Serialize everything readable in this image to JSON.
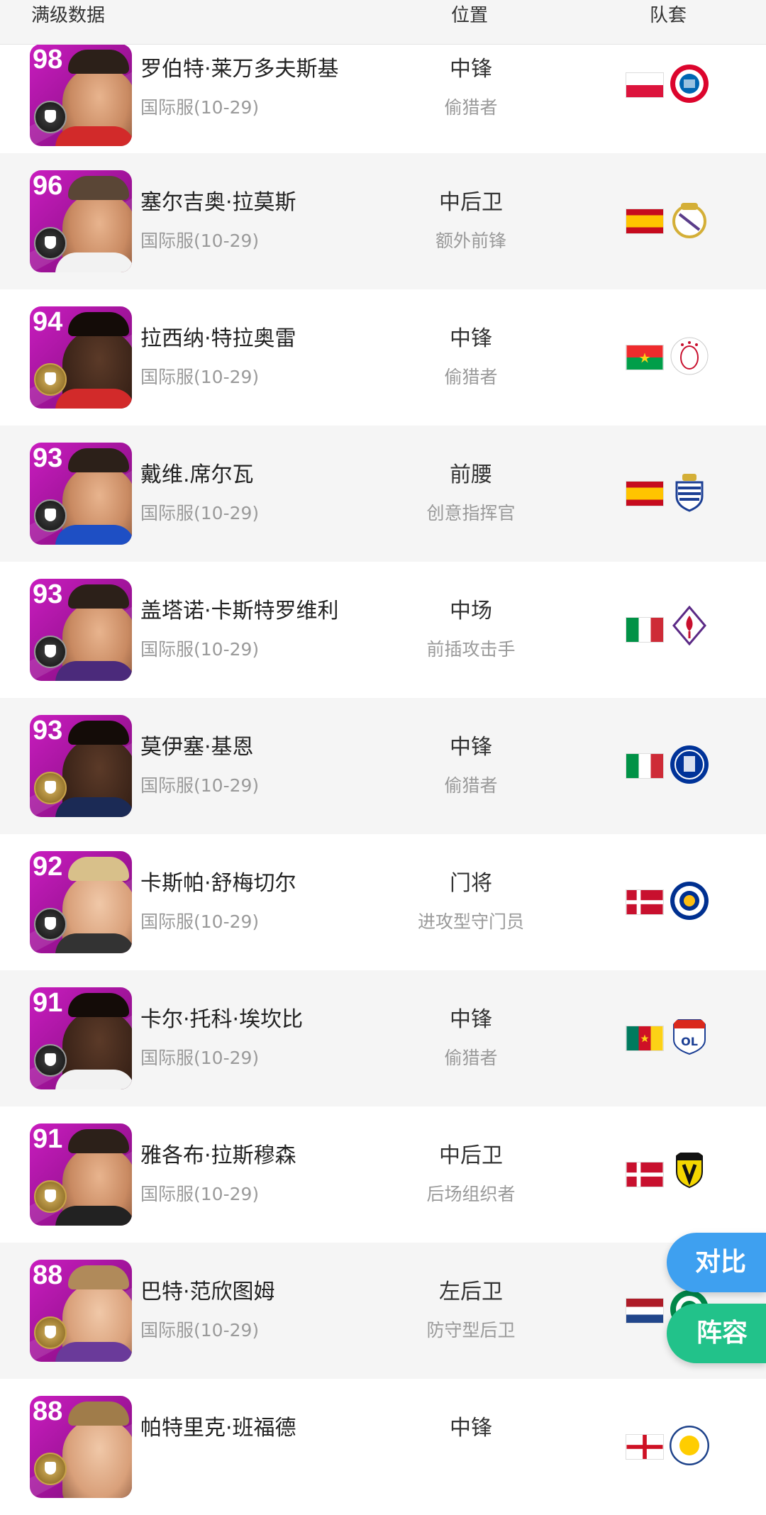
{
  "header": {
    "name_col": "满级数据",
    "pos_col": "位置",
    "team_col": "队套"
  },
  "players": [
    {
      "rating": "98",
      "name": "罗伯特·莱万多夫斯基",
      "server": "国际服(10-29)",
      "position": "中锋",
      "role": "偷猎者",
      "flag": "poland",
      "club": "bayern-munich",
      "badge": "black"
    },
    {
      "rating": "96",
      "name": "塞尔吉奥·拉莫斯",
      "server": "国际服(10-29)",
      "position": "中后卫",
      "role": "额外前锋",
      "flag": "spain",
      "club": "real-madrid",
      "badge": "black"
    },
    {
      "rating": "94",
      "name": "拉西纳·特拉奥雷",
      "server": "国际服(10-29)",
      "position": "中锋",
      "role": "偷猎者",
      "flag": "burkina-faso",
      "club": "ajax",
      "badge": "gold"
    },
    {
      "rating": "93",
      "name": "戴维.席尔瓦",
      "server": "国际服(10-29)",
      "position": "前腰",
      "role": "创意指挥官",
      "flag": "spain",
      "club": "real-sociedad",
      "badge": "black"
    },
    {
      "rating": "93",
      "name": "盖塔诺·卡斯特罗维利",
      "server": "国际服(10-29)",
      "position": "中场",
      "role": "前插攻击手",
      "flag": "italy",
      "club": "fiorentina",
      "badge": "black"
    },
    {
      "rating": "93",
      "name": "莫伊塞·基恩",
      "server": "国际服(10-29)",
      "position": "中锋",
      "role": "偷猎者",
      "flag": "italy",
      "club": "everton",
      "badge": "gold"
    },
    {
      "rating": "92",
      "name": "卡斯帕·舒梅切尔",
      "server": "国际服(10-29)",
      "position": "门将",
      "role": "进攻型守门员",
      "flag": "denmark",
      "club": "leicester-city",
      "badge": "black"
    },
    {
      "rating": "91",
      "name": "卡尔·托科·埃坎比",
      "server": "国际服(10-29)",
      "position": "中锋",
      "role": "偷猎者",
      "flag": "cameroon",
      "club": "olympique-lyonnais",
      "badge": "black"
    },
    {
      "rating": "91",
      "name": "雅各布·拉斯穆森",
      "server": "国际服(10-29)",
      "position": "中后卫",
      "role": "后场组织者",
      "flag": "denmark",
      "club": "vitesse",
      "badge": "gold"
    },
    {
      "rating": "88",
      "name": "巴特·范欣图姆",
      "server": "国际服(10-29)",
      "position": "左后卫",
      "role": "防守型后卫",
      "flag": "netherlands",
      "club": "celtic",
      "badge": "gold"
    },
    {
      "rating": "88",
      "name": "帕特里克·班福德",
      "server": "",
      "position": "中锋",
      "role": "",
      "flag": "england",
      "club": "leeds-united",
      "badge": "gold"
    }
  ],
  "buttons": {
    "compare": "对比",
    "lineup": "阵容"
  },
  "colors": {
    "card": "#b016a8",
    "compare": "#3ea0f0",
    "lineup": "#22c28a",
    "alt_row": "#f5f5f5"
  }
}
